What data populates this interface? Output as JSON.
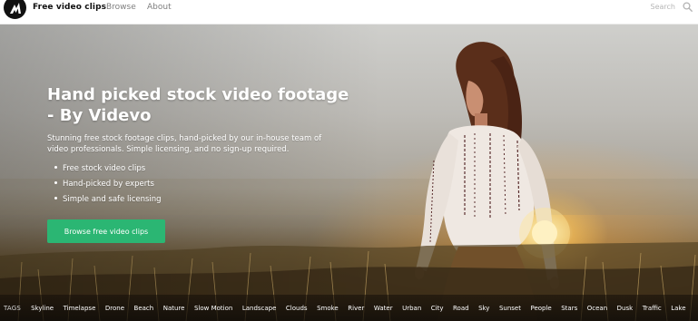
{
  "header": {
    "brand": "Free video clips",
    "nav": [
      {
        "label": "Browse"
      },
      {
        "label": "About"
      }
    ],
    "search": {
      "placeholder": "Search",
      "value": ""
    }
  },
  "hero": {
    "headline_lines": [
      "Hand picked stock video footage",
      "- By Videvo"
    ],
    "description_lines": [
      "Stunning free stock footage clips, hand-picked by our in-house team of",
      "video professionals. Simple licensing, and no sign-up required."
    ],
    "features": [
      "Free stock video clips",
      "Hand-picked by experts",
      "Simple and safe licensing"
    ],
    "cta_label": "Browse free video clips"
  },
  "tags": {
    "label": "TAGS",
    "items": [
      "Skyline",
      "Timelapse",
      "Drone",
      "Beach",
      "Nature",
      "Slow Motion",
      "Landscape",
      "Clouds",
      "Smoke",
      "River",
      "Water",
      "Urban",
      "City",
      "Road",
      "Sky",
      "Sunset",
      "People",
      "Stars",
      "Ocean",
      "Dusk",
      "Traffic",
      "Lake"
    ]
  },
  "colors": {
    "accent": "#2bb673",
    "text_muted": "#7f7f7f",
    "logo_bg": "#111111"
  },
  "icons": {
    "logo": "videvo-logo-icon",
    "search": "search-icon"
  }
}
